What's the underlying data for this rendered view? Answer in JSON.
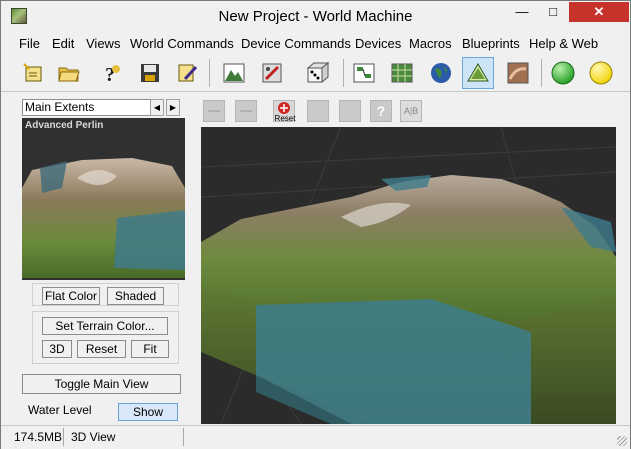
{
  "window": {
    "title": "New Project - World Machine"
  },
  "window_controls": {
    "minimize": "—",
    "maximize": "□",
    "close": "✕"
  },
  "menu": [
    "File",
    "Edit",
    "Views",
    "World Commands",
    "Device Commands",
    "Devices",
    "Macros",
    "Blueprints",
    "Help & Web"
  ],
  "toolbar": [
    {
      "name": "new-project-icon",
      "glyph": "✦"
    },
    {
      "name": "open-folder-icon",
      "glyph": "📂"
    },
    {
      "name": "help-question-icon",
      "glyph": "?"
    },
    {
      "name": "save-disk-icon",
      "glyph": "▣"
    },
    {
      "name": "wand-icon",
      "glyph": "✎"
    },
    {
      "name": "terrain-render-icon",
      "glyph": "⛰"
    },
    {
      "name": "device-settings-icon",
      "glyph": "⚙"
    },
    {
      "name": "dice-icon",
      "glyph": "⚄"
    },
    {
      "name": "device-workview-icon",
      "glyph": "▤"
    },
    {
      "name": "layout-view-icon",
      "glyph": "▦"
    },
    {
      "name": "globe-icon",
      "glyph": "◍"
    },
    {
      "name": "3d-view-icon",
      "glyph": "⛰"
    },
    {
      "name": "texture-view-icon",
      "glyph": "◆"
    },
    {
      "name": "green-build-icon",
      "glyph": "●"
    },
    {
      "name": "yellow-build-icon",
      "glyph": "●"
    }
  ],
  "toolbar_colors": {
    "green": "#29a12b",
    "yellow": "#f2d40c"
  },
  "left_panel": {
    "extents_selected": "Main Extents",
    "prev_arrow": "◀",
    "next_arrow": "▶",
    "preview_label": "Advanced Perlin",
    "flat_color": "Flat Color",
    "shaded": "Shaded",
    "set_terrain_color": "Set Terrain Color...",
    "btn_3d": "3D",
    "reset": "Reset",
    "fit": "Fit",
    "toggle_main_view": "Toggle Main View",
    "water_level_label": "Water Level",
    "show": "Show"
  },
  "view_toolbar": {
    "reset": "Reset",
    "help": "?",
    "ab": "A|B"
  },
  "statusbar": {
    "memory": "174.5MB",
    "mode": "3D View"
  }
}
